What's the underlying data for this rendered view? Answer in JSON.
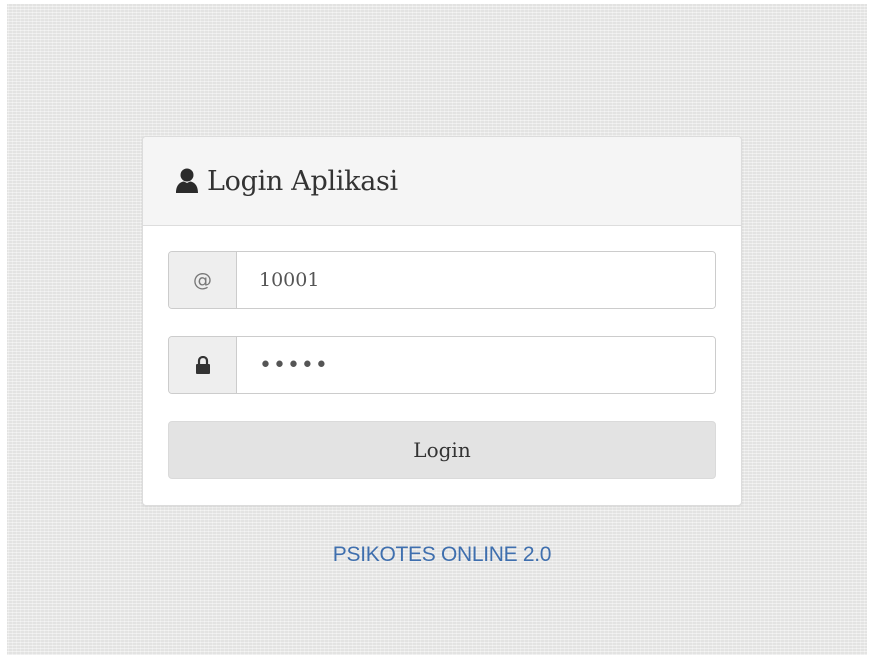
{
  "panel": {
    "title": "Login Aplikasi",
    "title_icon": "user-icon"
  },
  "username": {
    "addon_symbol": "@",
    "value": "10001"
  },
  "password": {
    "addon_icon": "lock-icon",
    "value": "•••••"
  },
  "login_button": {
    "label": "Login"
  },
  "footer": {
    "text": "PSIKOTES ONLINE 2.0"
  },
  "colors": {
    "background": "#ebebea",
    "panel_heading": "#f5f5f5",
    "button": "#e3e3e3",
    "footer_text": "#3f6fae"
  }
}
